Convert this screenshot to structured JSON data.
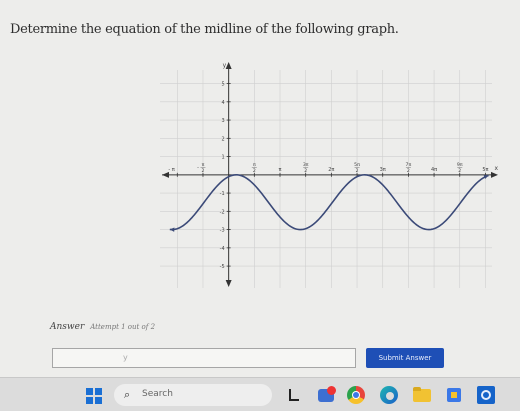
{
  "question": {
    "text": "Determine the equation of the midline of the following graph."
  },
  "graph": {
    "x_axis_label": "x",
    "y_axis_label": "y",
    "x_tick_labels": [
      {
        "value": -3.14159,
        "text": "π"
      },
      {
        "value": -1.5708,
        "num": "π",
        "den": "2"
      },
      {
        "value": 1.5708,
        "num": "π",
        "den": "2"
      },
      {
        "value": 3.14159,
        "text": "π"
      },
      {
        "value": 4.7124,
        "num": "3π",
        "den": "2"
      },
      {
        "value": 6.28319,
        "text": "2π"
      },
      {
        "value": 7.854,
        "num": "5π",
        "den": "2"
      },
      {
        "value": 9.4248,
        "text": "3π"
      },
      {
        "value": 10.9956,
        "num": "7π",
        "den": "2"
      },
      {
        "value": 12.5664,
        "text": "4π"
      },
      {
        "value": 14.1372,
        "num": "9π",
        "den": "2"
      },
      {
        "value": 15.708,
        "text": "5π"
      }
    ],
    "y_tick_labels": [
      {
        "value": 5,
        "text": "5"
      },
      {
        "value": 4,
        "text": "4"
      },
      {
        "value": 3,
        "text": "3"
      },
      {
        "value": 2,
        "text": "2"
      },
      {
        "value": 1,
        "text": "1"
      },
      {
        "value": -1,
        "text": "-1"
      },
      {
        "value": -2,
        "text": "-2"
      },
      {
        "value": -3,
        "text": "-3"
      },
      {
        "value": -4,
        "text": "-4"
      },
      {
        "value": -5,
        "text": "-5"
      }
    ]
  },
  "chart_data": {
    "type": "line",
    "xlim": [
      -4.2,
      16.6
    ],
    "ylim": [
      -6.2,
      6.4
    ],
    "grid": true,
    "series": [
      {
        "function": "y = 1.5*sin(0.8*x + 1.2) - 1.5",
        "amplitude": 1.5,
        "midline": -1.5,
        "max": 0,
        "min": -3,
        "x_start": -3.6,
        "x_end": 15.9,
        "color": "#3b4a78"
      }
    ]
  },
  "answer": {
    "label": "Answer",
    "attempt_text": "Attempt 1 out of 2",
    "input_value": "y",
    "submit_label": "Submit Answer"
  },
  "taskbar": {
    "search_placeholder": "Search"
  }
}
